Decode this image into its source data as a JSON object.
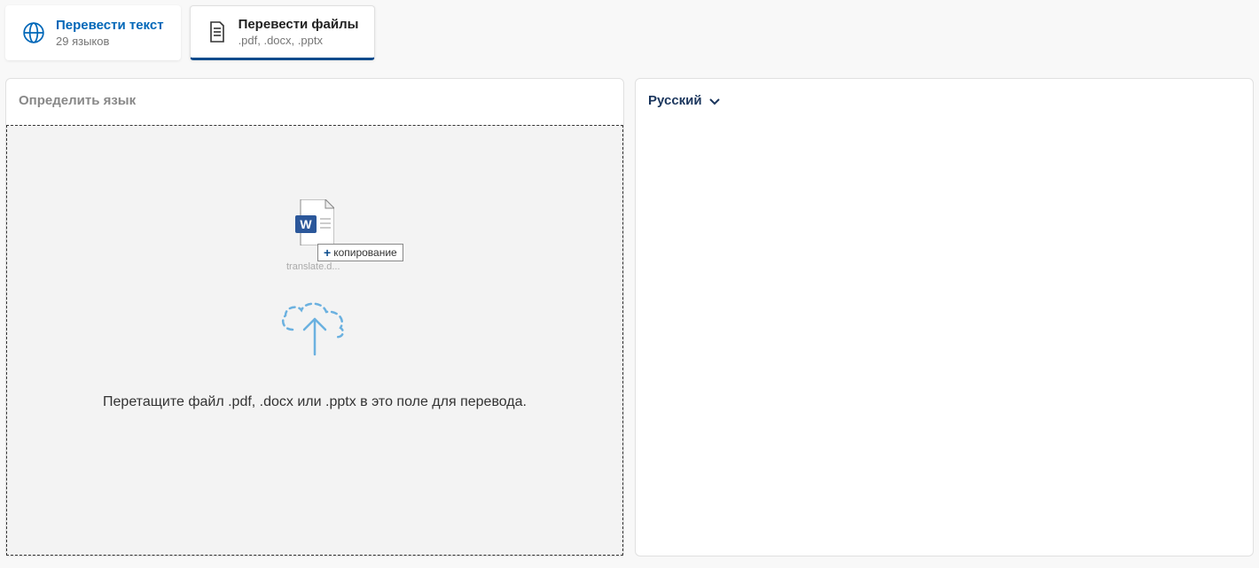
{
  "tabs": {
    "text": {
      "title": "Перевести текст",
      "subtitle": "29 языков"
    },
    "files": {
      "title": "Перевести файлы",
      "subtitle": ".pdf, .docx, .pptx"
    }
  },
  "source": {
    "header": "Определить язык",
    "drop_text": "Перетащите файл .pdf, .docx или .pptx в это поле для перевода.",
    "copy_badge": "копирование",
    "filename": "translate.d..."
  },
  "target": {
    "header": "Русский"
  }
}
